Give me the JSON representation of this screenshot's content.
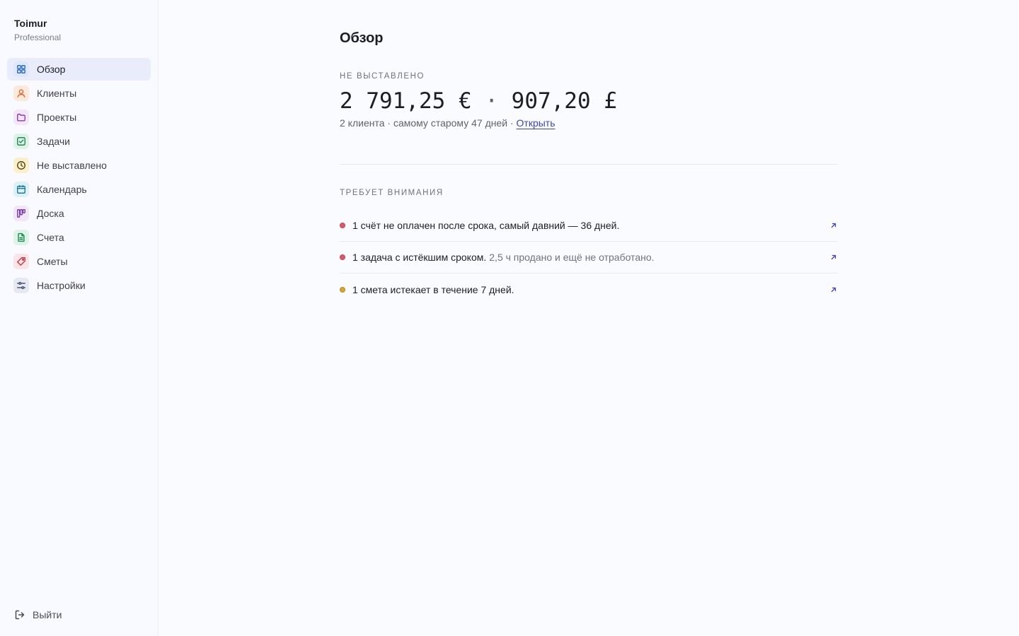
{
  "brand": {
    "name": "Toimur",
    "plan": "Professional"
  },
  "sidebar": {
    "items": [
      {
        "label": "Обзор",
        "icon": "grid-icon",
        "active": true,
        "color": "#2c6fb8",
        "bg": "#dfe8fb"
      },
      {
        "label": "Клиенты",
        "icon": "user-icon",
        "color": "#d9692a",
        "bg": "#fde9dc"
      },
      {
        "label": "Проекты",
        "icon": "folder-icon",
        "color": "#8a3fa8",
        "bg": "#f3e6f8"
      },
      {
        "label": "Задачи",
        "icon": "check-square-icon",
        "color": "#1f8a55",
        "bg": "#dcf3e6"
      },
      {
        "label": "Не выставлено",
        "icon": "clock-icon",
        "color": "#6a5510",
        "bg": "#fbf0c9"
      },
      {
        "label": "Календарь",
        "icon": "calendar-icon",
        "color": "#1f7a99",
        "bg": "#dcf0f7"
      },
      {
        "label": "Доска",
        "icon": "kanban-icon",
        "color": "#7a3fa8",
        "bg": "#f0e6f8"
      },
      {
        "label": "Счета",
        "icon": "file-icon",
        "color": "#1f8a55",
        "bg": "#dcf3e6"
      },
      {
        "label": "Сметы",
        "icon": "tag-icon",
        "color": "#c23a4a",
        "bg": "#fbe3e6"
      },
      {
        "label": "Настройки",
        "icon": "sliders-icon",
        "color": "#3e4a66",
        "bg": "#e6e9f1"
      }
    ],
    "logout_label": "Выйти"
  },
  "main": {
    "title": "Обзор",
    "unbilled": {
      "label": "НЕ ВЫСТАВЛЕНО",
      "amount_eur": "2 791,25 €",
      "separator": "·",
      "amount_gbp": "907,20 £",
      "meta": "2 клиента · самому старому 47 дней · ",
      "link": "Открыть"
    },
    "attention": {
      "label": "ТРЕБУЕТ ВНИМАНИЯ",
      "items": [
        {
          "text": "1 счёт не оплачен после срока, самый давний — 36 дней.",
          "sub": "",
          "status_color": "#e0566a"
        },
        {
          "text": "1 задача с истёкшим сроком.",
          "sub": "2,5 ч продано и ещё не отработано.",
          "status_color": "#e0566a"
        },
        {
          "text": "1 смета истекает в течение 7 дней.",
          "sub": "",
          "status_color": "#d4a72c"
        }
      ]
    }
  },
  "colors": {
    "accent": "#3b45c4",
    "active_bg": "#e9edfb"
  }
}
